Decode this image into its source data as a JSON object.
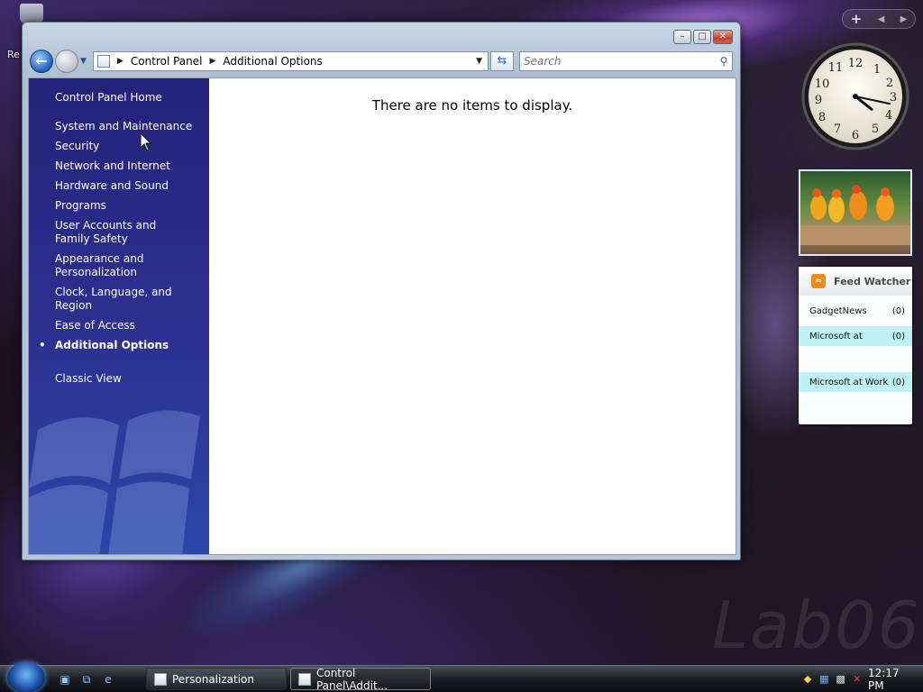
{
  "desktop": {
    "recycle_label": "Re",
    "watermark": "Lab06"
  },
  "window": {
    "min_label": "–",
    "max_label": "□",
    "close_label": "✕",
    "back_icon": "back-arrow-icon",
    "address": {
      "crumbs": [
        "Control Panel",
        "Additional Options"
      ]
    },
    "search": {
      "placeholder": "Search"
    },
    "sidebar": {
      "home": "Control Panel Home",
      "items": [
        "System and Maintenance",
        "Security",
        "Network and Internet",
        "Hardware and Sound",
        "Programs",
        "User Accounts and Family Safety",
        "Appearance and Personalization",
        "Clock, Language, and Region",
        "Ease of Access",
        "Additional Options"
      ],
      "active_item": "Additional Options",
      "classic_view": "Classic View"
    },
    "main": {
      "empty_message": "There are no items to display."
    }
  },
  "gadgets": {
    "clock": {
      "hour": 4,
      "minute": 17
    },
    "feed": {
      "title": "Feed Watcher",
      "rows": [
        {
          "name": "GadgetNews",
          "count": "(0)"
        },
        {
          "name": "Microsoft at",
          "count": "(0)"
        },
        {
          "name": "Microsoft at Work",
          "count": "(0)"
        }
      ]
    }
  },
  "taskbar": {
    "tasks": [
      {
        "label": "Personalization"
      },
      {
        "label": "Control Panel\\Addit..."
      }
    ],
    "time": "12:17 PM"
  }
}
